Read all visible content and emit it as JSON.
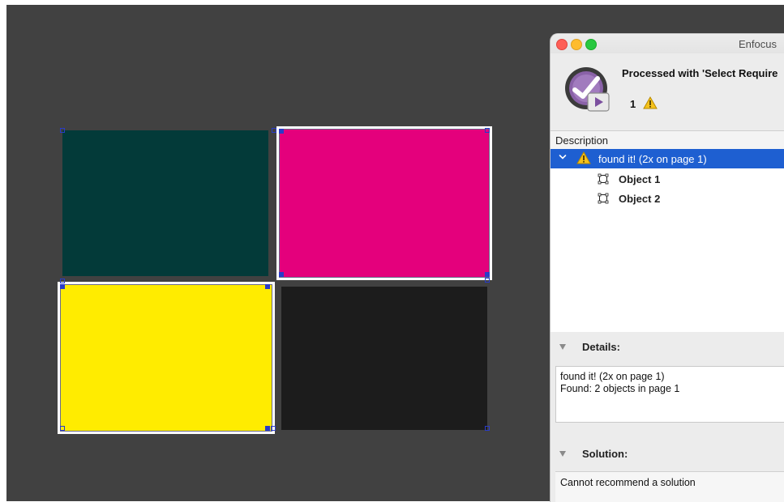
{
  "window": {
    "title": "Enfocus",
    "processed_text": "Processed with 'Select Require",
    "warning_count": "1"
  },
  "outline": {
    "column_header": "Description",
    "issue": {
      "label": "found it! (2x on page 1)"
    },
    "objects": [
      {
        "label": "Object 1"
      },
      {
        "label": "Object 2"
      }
    ]
  },
  "details": {
    "heading": "Details:",
    "lines": [
      "found it! (2x on page 1)",
      "Found: 2 objects in page 1"
    ]
  },
  "solution": {
    "heading": "Solution:",
    "text": "Cannot recommend a solution"
  },
  "document_swatches": [
    {
      "name": "dark-teal",
      "color": "#033a39",
      "selected": false
    },
    {
      "name": "magenta",
      "color": "#e4007c",
      "selected": true
    },
    {
      "name": "yellow",
      "color": "#ffec00",
      "selected": true
    },
    {
      "name": "black",
      "color": "#1c1c1c",
      "selected": false
    }
  ],
  "colors": {
    "canvas": "#414141",
    "selection_blue": "#1e5fd1",
    "handle_blue": "#2a3cc8"
  },
  "icons": {
    "logo": "enfocus-pitstop-logo",
    "warning": "warning-triangle-icon",
    "object": "object-bounds-icon",
    "disclosure": "disclosure-triangle-icon"
  }
}
